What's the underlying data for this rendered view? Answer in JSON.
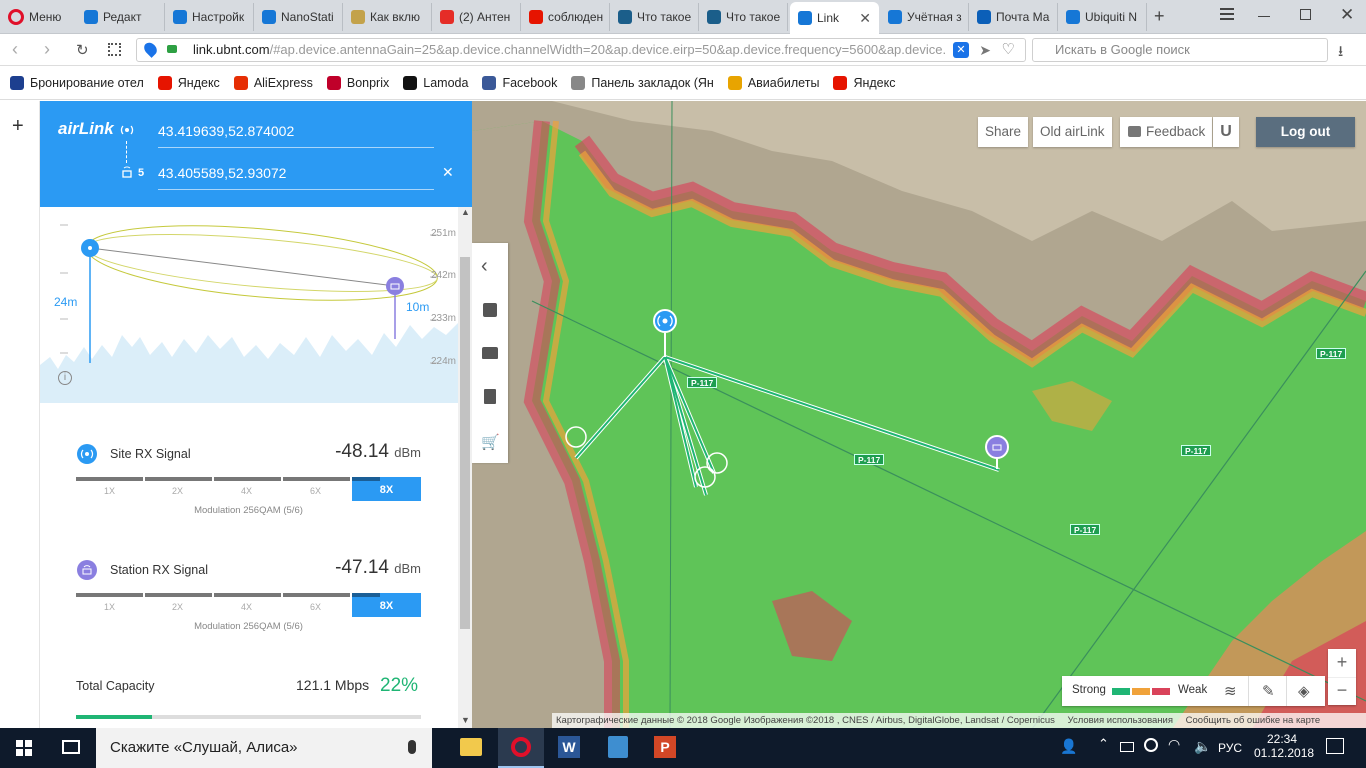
{
  "browser": {
    "menu_label": "Меню",
    "tabs": [
      {
        "label": "Редакт",
        "icon": "ubiquiti-icon",
        "color": "#1677d6"
      },
      {
        "label": "Настройк",
        "icon": "ubiquiti-icon",
        "color": "#1677d6"
      },
      {
        "label": "NanoStati",
        "icon": "ubiquiti-icon",
        "color": "#1677d6"
      },
      {
        "label": "Как вклю",
        "icon": "site-icon",
        "color": "#c3a24a"
      },
      {
        "label": "(2) Антен",
        "icon": "youtube-icon",
        "color": "#e52d27"
      },
      {
        "label": "соблюден",
        "icon": "yandex-icon",
        "color": "#e61400"
      },
      {
        "label": "Что такое",
        "icon": "wifi-icon",
        "color": "#1b5e8a"
      },
      {
        "label": "Что такое",
        "icon": "wifi-icon",
        "color": "#1b5e8a"
      },
      {
        "label": "Link",
        "icon": "ubiquiti-icon",
        "color": "#1677d6",
        "active": true
      },
      {
        "label": "Учётная з",
        "icon": "ubiquiti-icon",
        "color": "#1677d6"
      },
      {
        "label": "Почта Ма",
        "icon": "mail-icon",
        "color": "#0b5fb8"
      },
      {
        "label": "Ubiquiti N",
        "icon": "ubiquiti-icon",
        "color": "#1677d6"
      }
    ],
    "url_host": "link.ubnt.com",
    "url_rest": "/#ap.device.antennaGain=25&ap.device.channelWidth=20&ap.device.eirp=50&ap.device.frequency=5600&ap.device.",
    "search_placeholder": "Искать в Google поиск",
    "bookmarks": [
      {
        "label": "Бронирование отел",
        "icon": "booking-icon"
      },
      {
        "label": "Яндекс",
        "icon": "yandex-icon"
      },
      {
        "label": "AliExpress",
        "icon": "aliexpress-icon"
      },
      {
        "label": "Bonprix",
        "icon": "bonprix-icon"
      },
      {
        "label": "Lamoda",
        "icon": "lamoda-icon"
      },
      {
        "label": "Facebook",
        "icon": "facebook-icon"
      },
      {
        "label": "Панель закладок (Ян",
        "icon": "folder-icon"
      },
      {
        "label": "Авиабилеты",
        "icon": "plane-icon"
      },
      {
        "label": "Яндекс",
        "icon": "yandex-icon"
      }
    ]
  },
  "airlink": {
    "logo": "airLink",
    "site_coords": "43.419639,52.874002",
    "station_count": "5",
    "station_coords": "43.405589,52.93072",
    "profile": {
      "site_height": "24m",
      "station_height": "10m",
      "elevation_ticks": [
        "251m",
        "242m",
        "233m",
        "224m"
      ]
    },
    "site_rx": {
      "label": "Site RX Signal",
      "value": "-48.14",
      "unit": "dBm",
      "levels": [
        "1X",
        "2X",
        "4X",
        "6X",
        "8X"
      ],
      "active_level": "8X",
      "modulation": "Modulation 256QAM (5/6)"
    },
    "station_rx": {
      "label": "Station RX Signal",
      "value": "-47.14",
      "unit": "dBm",
      "levels": [
        "1X",
        "2X",
        "4X",
        "6X",
        "8X"
      ],
      "active_level": "8X",
      "modulation": "Modulation 256QAM (5/6)"
    },
    "capacity": {
      "label": "Total Capacity",
      "value": "121.1 Mbps",
      "percent": "22%",
      "fraction": 0.22
    }
  },
  "map": {
    "buttons": {
      "share": "Share",
      "old": "Old airLink",
      "feedback": "Feedback",
      "logout": "Log out"
    },
    "road_labels": [
      "P-117",
      "P-117",
      "P-117",
      "P-117",
      "P-117"
    ],
    "legend": {
      "strong": "Strong",
      "weak": "Weak",
      "colors": [
        "#1fb574",
        "#f0a23a",
        "#d9435a"
      ]
    },
    "copyright": "Картографические данные © 2018 Google Изображения ©2018 , CNES / Airbus, DigitalGlobe, Landsat / Copernicus",
    "terms": "Условия использования",
    "report": "Сообщить об ошибке на карте"
  },
  "taskbar": {
    "search_text": "Скажите «Слушай, Алиса»",
    "lang": "РУС",
    "time": "22:34",
    "date": "01.12.2018"
  }
}
